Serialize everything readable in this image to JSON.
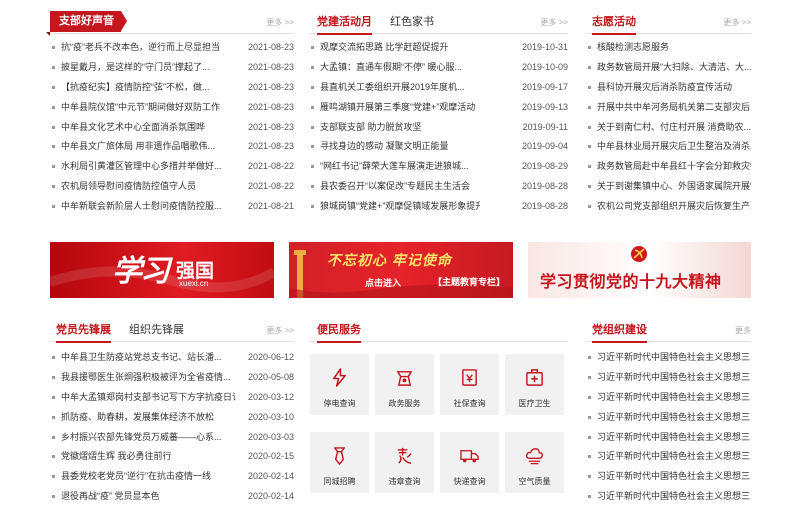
{
  "panel1": {
    "flag": "支部好声音",
    "more": "更多 >>",
    "items": [
      {
        "title": "抗“疫”老兵不改本色，逆行而上尽显担当",
        "date": "2021-08-23"
      },
      {
        "title": "披星戴月，是这样的“守门员”撑起了...",
        "date": "2021-08-23"
      },
      {
        "title": "【抗疫纪实】疫情防控“弦”不松，做...",
        "date": "2021-08-23"
      },
      {
        "title": "中牟县院仪馆“中元节”期间做好双防工作",
        "date": "2021-08-23"
      },
      {
        "title": "中牟县文化艺术中心全面消杀氛围哗",
        "date": "2021-08-23"
      },
      {
        "title": "中牟县文广旅体局 用非遗作品唱歌伟...",
        "date": "2021-08-23"
      },
      {
        "title": "水利局引黄灌区管理中心多措并举做好...",
        "date": "2021-08-22"
      },
      {
        "title": "农机局领导慰问疫情防控值守人员",
        "date": "2021-08-22"
      },
      {
        "title": "中牟新联会新阶层人士慰问疫情防控服...",
        "date": "2021-08-21"
      }
    ]
  },
  "panel2": {
    "tab1": "党建活动月",
    "tab2": "红色家书",
    "more": "更多 >>",
    "items": [
      {
        "title": "观摩交流拓思路 比学赶超促提升",
        "date": "2019-10-31"
      },
      {
        "title": "大孟镇：直通车假期“不停” 暖心服...",
        "date": "2019-10-09"
      },
      {
        "title": "县直机关工委组织开展2019年度机...",
        "date": "2019-09-17"
      },
      {
        "title": "雁鸣湖镇开展第三季度“党建+”观摩活动",
        "date": "2019-09-13"
      },
      {
        "title": "支部联支部 助力脱贫攻坚",
        "date": "2019-09-11"
      },
      {
        "title": "寻找身边的感动 凝聚文明正能量",
        "date": "2019-09-04"
      },
      {
        "title": "“网红书记”薛荣大莲车展演走进狼城...",
        "date": "2019-08-29"
      },
      {
        "title": "县农委召开“以案促改”专题民主生活会",
        "date": "2019-08-28"
      },
      {
        "title": "狼城岗镇“党建+”观摩促镇域发展形象提升",
        "date": "2019-08-28"
      }
    ]
  },
  "panel3": {
    "tab1": "志愿活动",
    "more": "更多 >>",
    "items": [
      {
        "title": "核酸检测志愿服务"
      },
      {
        "title": "政务数管局开展“大扫除、大清洁、大..."
      },
      {
        "title": "县科协开展灾后消杀防疫宣传活动"
      },
      {
        "title": "开展中共中牟河务局机关第二支部灾后..."
      },
      {
        "title": "关于到南仁村、付庄村开展 消费助农..."
      },
      {
        "title": "中牟县林业局开展灾后卫生整治及消杀..."
      },
      {
        "title": "政务数管局赴中牟县红十字会分卸救灾物..."
      },
      {
        "title": "关于到谢集镇中心、外国语家属院开展“..."
      },
      {
        "title": "农机公司党支部组织开展灾后恢复生产..."
      }
    ]
  },
  "banners": {
    "b1_big": "学习",
    "b1_small": "强国",
    "b1_url": "xuexi.cn",
    "b2_main": "不忘初心 牢记使命",
    "b2_enter": "点击进入",
    "b2_tag": "【主题教育专栏】",
    "b3_text": "学习贯彻党的十九大精神"
  },
  "panel4": {
    "tab1": "党员先锋展",
    "tab2": "组织先锋展",
    "more": "更多 >>",
    "items": [
      {
        "title": "中牟县卫生防疫站党总支书记、站长潘...",
        "date": "2020-06-12"
      },
      {
        "title": "我县援鄂医生张炯强积极被评为全省疫情...",
        "date": "2020-05-08"
      },
      {
        "title": "中牟大孟镇郑岗村支部书记写下方字抗疫日记",
        "date": "2020-03-12"
      },
      {
        "title": "抓防疫、助春耕，发展集体经济不放松",
        "date": "2020-03-10"
      },
      {
        "title": "乡村振兴农部先锋党员万威蕃——心系...",
        "date": "2020-03-03"
      },
      {
        "title": "党徽熠熠生辉 我必勇往前行",
        "date": "2020-02-15"
      },
      {
        "title": "县委党校老党员“逆行”在抗击疫情一线",
        "date": "2020-02-14"
      },
      {
        "title": "退役再战“疫” 党员显本色",
        "date": "2020-02-14"
      }
    ]
  },
  "panel5": {
    "tab1": "便民服务",
    "services": [
      {
        "label": "停电查询",
        "icon": "power-icon"
      },
      {
        "label": "政务服务",
        "icon": "government-service-icon"
      },
      {
        "label": "社保查询",
        "icon": "social-security-icon"
      },
      {
        "label": "医疗卫生",
        "icon": "medical-icon"
      },
      {
        "label": "同城招聘",
        "icon": "recruitment-icon"
      },
      {
        "label": "违章查询",
        "icon": "traffic-violation-icon"
      },
      {
        "label": "快递查询",
        "icon": "express-truck-icon"
      },
      {
        "label": "空气质量",
        "icon": "air-quality-icon"
      }
    ]
  },
  "panel6": {
    "tab1": "党组织建设",
    "more": "更多",
    "items": [
      {
        "title": "习近平新时代中国特色社会主义思想三..."
      },
      {
        "title": "习近平新时代中国特色社会主义思想三..."
      },
      {
        "title": "习近平新时代中国特色社会主义思想三..."
      },
      {
        "title": "习近平新时代中国特色社会主义思想三..."
      },
      {
        "title": "习近平新时代中国特色社会主义思想三..."
      },
      {
        "title": "习近平新时代中国特色社会主义思想三..."
      },
      {
        "title": "习近平新时代中国特色社会主义思想三..."
      },
      {
        "title": "习近平新时代中国特色社会主义思想三..."
      }
    ]
  },
  "colors": {
    "accent": "#c4161c",
    "tile_bg": "#f1f1f1"
  }
}
